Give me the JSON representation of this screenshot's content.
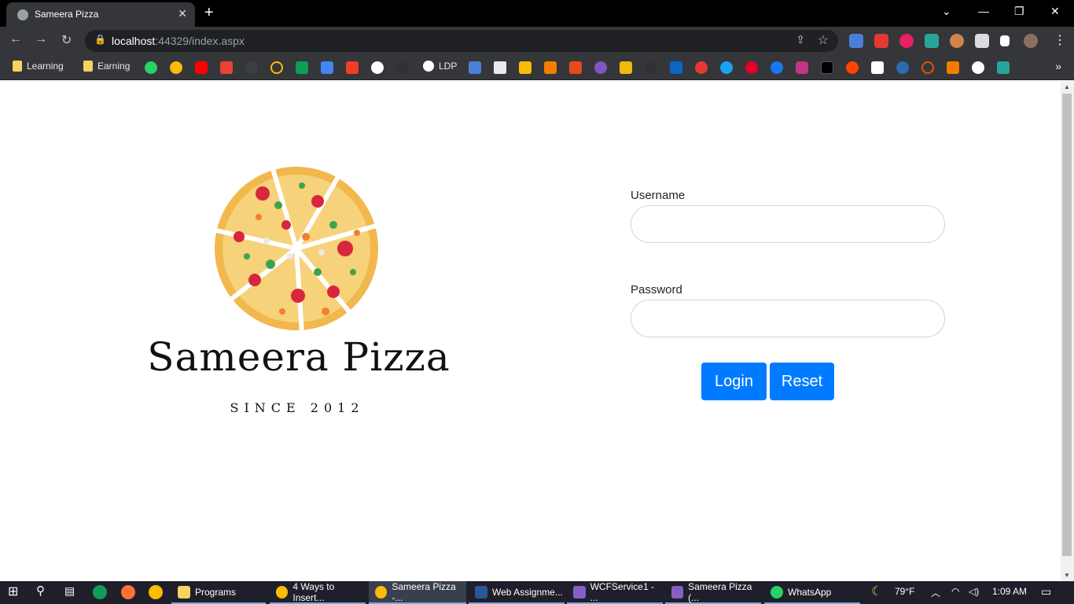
{
  "browser": {
    "tab_title": "Sameera Pizza",
    "tab_close": "✕",
    "new_tab": "+",
    "url_host": "localhost",
    "url_path": ":44329/index.aspx",
    "bookmarks": [
      "Learning",
      "Earning",
      "LDP"
    ],
    "more": "»"
  },
  "page": {
    "brand_name": "Sameera Pizza",
    "brand_tagline": "SINCE 2012",
    "username_label": "Username",
    "password_label": "Password",
    "username_value": "",
    "password_value": "",
    "login_button": "Login",
    "reset_button": "Reset",
    "accent_color": "#007bff"
  },
  "taskbar": {
    "items": [
      "Programs",
      "4 Ways to Insert...",
      "Sameera Pizza -...",
      "Web Assignme...",
      "WCFService1 - ...",
      "Sameera Pizza (...",
      "WhatsApp"
    ],
    "temperature": "79°F",
    "time": "1:09 AM"
  }
}
